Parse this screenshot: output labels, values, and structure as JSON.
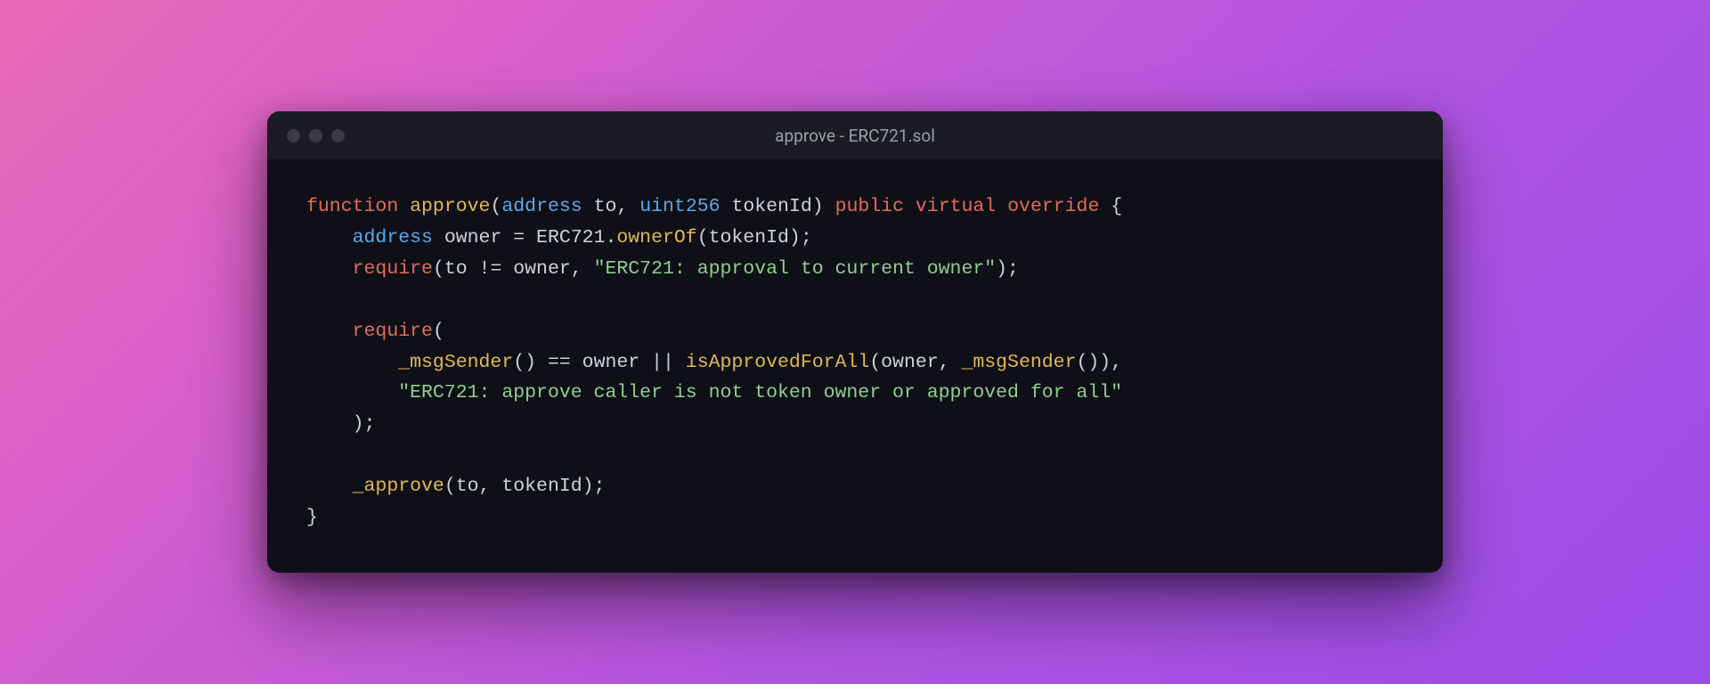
{
  "window": {
    "title": "approve - ERC721.sol"
  },
  "code": {
    "l1": {
      "kw1": "function",
      "fn": "approve",
      "p1": "(",
      "ty1": "address",
      "id1": " to",
      "c1": ", ",
      "ty2": "uint256",
      "id2": " tokenId",
      "p2": ")",
      "sp": " ",
      "kw2": "public",
      "sp2": " ",
      "kw3": "virtual",
      "sp3": " ",
      "kw4": "override",
      "br": " {"
    },
    "l2": {
      "pad": "    ",
      "ty": "address",
      "rest": " owner = ERC721.",
      "fn": "ownerOf",
      "args": "(tokenId);"
    },
    "l3": {
      "pad": "    ",
      "kw": "require",
      "open": "(to != owner, ",
      "str": "\"ERC721: approval to current owner\"",
      "close": ");"
    },
    "l4": {
      "blank": ""
    },
    "l5": {
      "pad": "    ",
      "kw": "require",
      "open": "("
    },
    "l6": {
      "pad": "        ",
      "fn1": "_msgSender",
      "p1": "()",
      "mid": " == owner || ",
      "fn2": "isApprovedForAll",
      "args": "(owner, ",
      "fn3": "_msgSender",
      "p3": "()),"
    },
    "l7": {
      "pad": "        ",
      "str": "\"ERC721: approve caller is not token owner or approved for all\""
    },
    "l8": {
      "pad": "    ",
      "close": ");"
    },
    "l9": {
      "blank": ""
    },
    "l10": {
      "pad": "    ",
      "fn": "_approve",
      "args": "(to, tokenId);"
    },
    "l11": {
      "brace": "}"
    }
  }
}
